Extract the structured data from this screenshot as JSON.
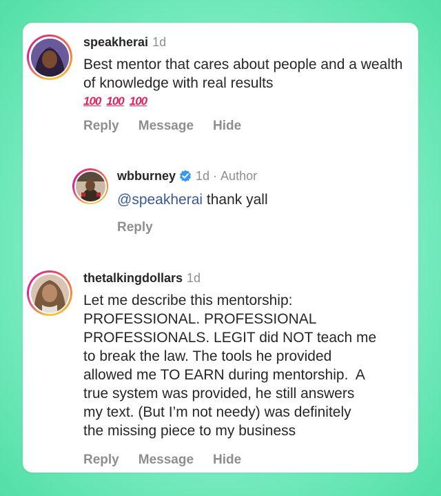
{
  "comments": [
    {
      "username": "speakherai",
      "time": "1d",
      "text": "Best mentor that cares about people and a wealth of knowledge with real results",
      "emoji": [
        "100",
        "100",
        "100"
      ],
      "actions": {
        "reply": "Reply",
        "message": "Message",
        "hide": "Hide"
      }
    },
    {
      "username": "wbburney",
      "time": "1d",
      "separator": "·",
      "author_label": "Author",
      "mention": "@speakherai",
      "text": " thank yall",
      "actions": {
        "reply": "Reply"
      }
    },
    {
      "username": "thetalkingdollars",
      "time": "1d",
      "text": "Let me describe this mentorship:\nPROFESSIONAL. PROFESSIONAL\nPROFESSIONALS. LEGIT did NOT teach me\nto break the law. The tools he provided\nallowed me TO EARN during mentorship.  A\ntrue system was provided, he still answers\nmy text. (But I’m not needy) was definitely\nthe missing piece to my business",
      "actions": {
        "reply": "Reply",
        "message": "Message",
        "hide": "Hide"
      }
    }
  ],
  "colors": {
    "accent_link": "#385898",
    "verified_badge": "#3897f0",
    "muted": "#8e8e8e",
    "text": "#262626"
  }
}
